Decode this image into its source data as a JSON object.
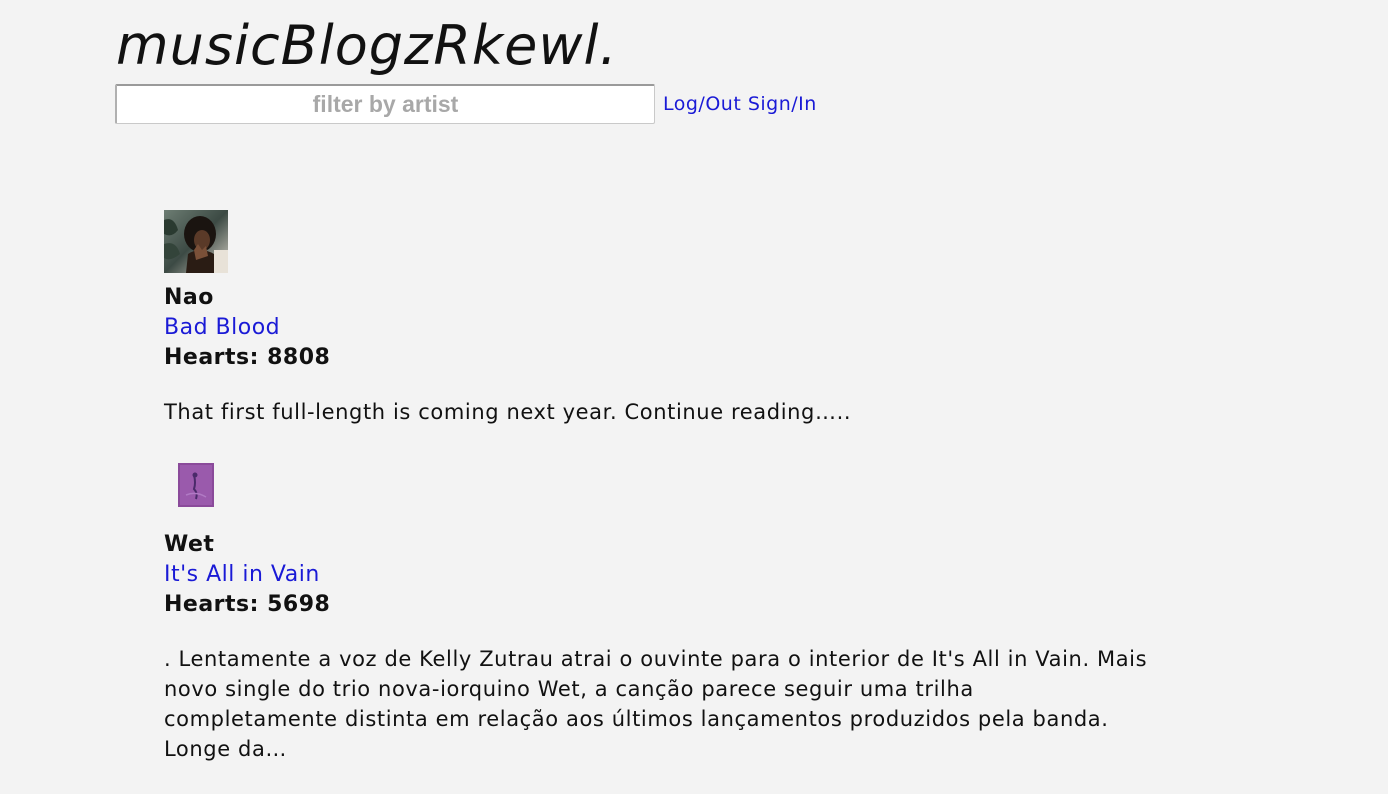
{
  "site": {
    "title": "musicBlogzRkewl."
  },
  "search": {
    "placeholder": "filter by artist",
    "value": ""
  },
  "auth": {
    "link_label": "Log/Out Sign/In"
  },
  "colors": {
    "background": "#f3f3f3",
    "link": "#1a1ad6",
    "text": "#111111"
  },
  "posts": [
    {
      "artist": "Nao",
      "song": "Bad Blood",
      "hearts": "Hearts: 8808",
      "excerpt": "That first full-length is coming next year. Continue reading…..",
      "thumbnail": "artist-photo"
    },
    {
      "artist": "Wet",
      "song": "It's All in Vain",
      "hearts": "Hearts: 5698",
      "excerpt": ". Lentamente a voz de Kelly Zutrau atrai o ouvinte para o interior de It's All in Vain. Mais novo single do trio nova-iorquino Wet, a canção parece seguir uma trilha completamente distinta em relação aos últimos lançamentos produzidos pela banda. Longe da…",
      "thumbnail": "album-cover"
    }
  ]
}
